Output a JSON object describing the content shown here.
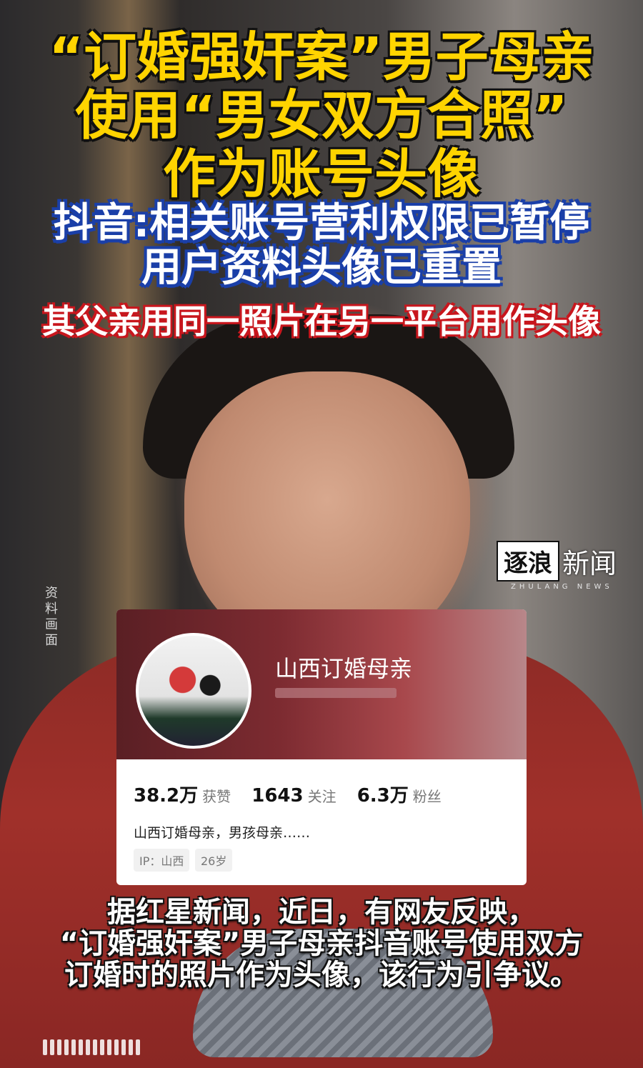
{
  "headline": {
    "line1": "“订婚强奸案”男子母亲",
    "line2": "使用“男女双方合照”",
    "line3": "作为账号头像"
  },
  "subtitle": {
    "line1": "抖音:相关账号营利权限已暂停",
    "line2": "用户资料头像已重置"
  },
  "red_note": "其父亲用同一照片在另一平台用作头像",
  "logo": {
    "box": "逐浪",
    "text": "新闻",
    "sub": "ZHULANG NEWS"
  },
  "side_label": "资料画面",
  "profile_card": {
    "name": "山西订婚母亲",
    "stats": [
      {
        "value": "38.2万",
        "label": "获赞"
      },
      {
        "value": "1643",
        "label": "关注"
      },
      {
        "value": "6.3万",
        "label": "粉丝"
      }
    ],
    "bio": "山西订婚母亲，男孩母亲……",
    "tags": [
      "IP：山西",
      "26岁"
    ]
  },
  "caption": {
    "line1": "据红星新闻，近日，有网友反映，",
    "line2": "“订婚强奸案”男子母亲抖音账号使用双方",
    "line3": "订婚时的照片作为头像，该行为引争议。"
  },
  "colors": {
    "headline": "#ffd400",
    "subtitle_outline": "#1a3fa8",
    "note_outline": "#c8161d"
  }
}
